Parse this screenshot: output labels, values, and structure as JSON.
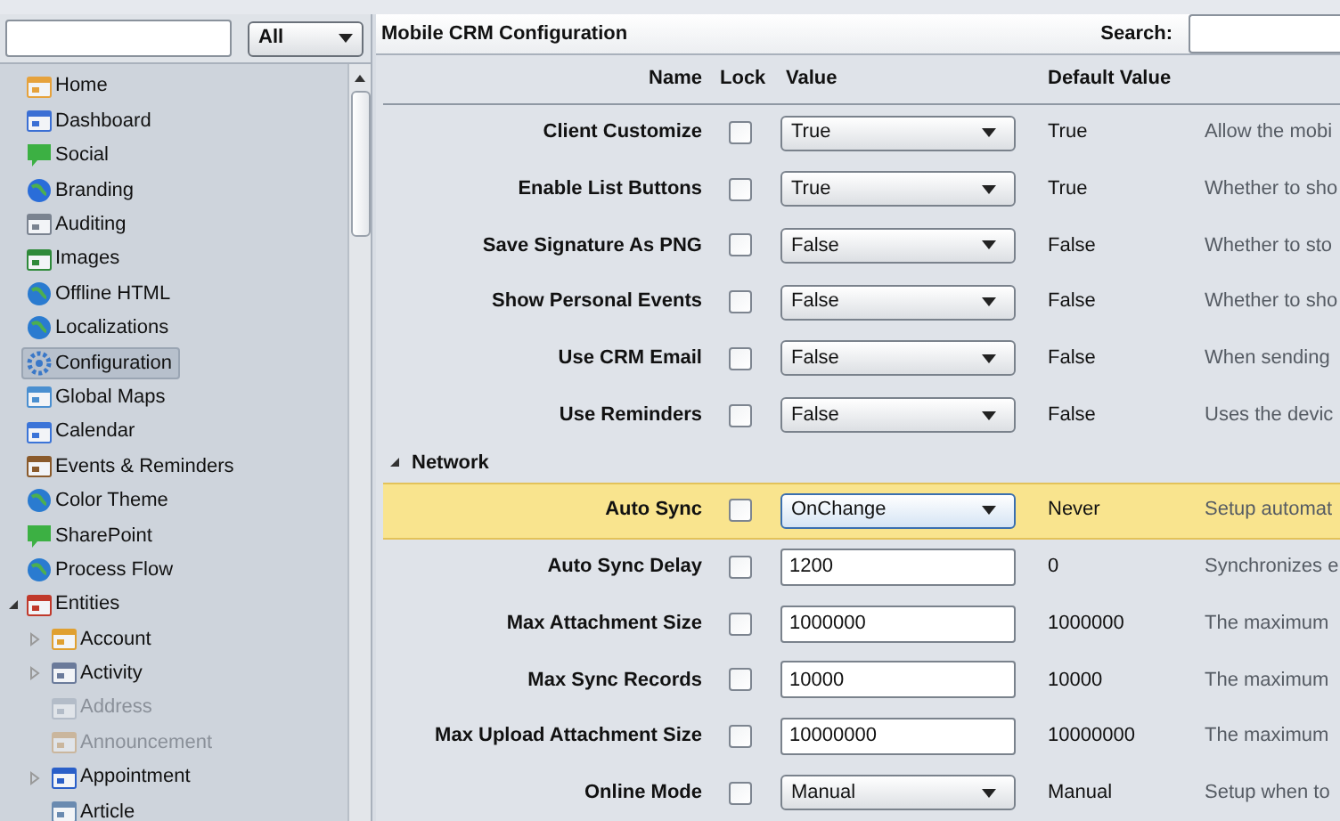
{
  "sidebar": {
    "filter": {
      "value": "All"
    },
    "items": [
      {
        "label": "Home",
        "selected": false
      },
      {
        "label": "Dashboard",
        "selected": false
      },
      {
        "label": "Social",
        "selected": false
      },
      {
        "label": "Branding",
        "selected": false
      },
      {
        "label": "Auditing",
        "selected": false
      },
      {
        "label": "Images",
        "selected": false
      },
      {
        "label": "Offline HTML",
        "selected": false
      },
      {
        "label": "Localizations",
        "selected": false
      },
      {
        "label": "Configuration",
        "selected": true
      },
      {
        "label": "Global Maps",
        "selected": false
      },
      {
        "label": "Calendar",
        "selected": false
      },
      {
        "label": "Events & Reminders",
        "selected": false
      },
      {
        "label": "Color Theme",
        "selected": false
      },
      {
        "label": "SharePoint",
        "selected": false
      },
      {
        "label": "Process Flow",
        "selected": false
      },
      {
        "label": "Entities",
        "selected": false,
        "expanded": true,
        "children": [
          {
            "label": "Account",
            "expandable": true,
            "disabled": false
          },
          {
            "label": "Activity",
            "expandable": true,
            "disabled": false
          },
          {
            "label": "Address",
            "expandable": false,
            "disabled": true
          },
          {
            "label": "Announcement",
            "expandable": false,
            "disabled": true
          },
          {
            "label": "Appointment",
            "expandable": true,
            "disabled": false
          },
          {
            "label": "Article",
            "expandable": false,
            "disabled": false
          }
        ]
      }
    ]
  },
  "main": {
    "title": "Mobile CRM Configuration",
    "search": {
      "label": "Search:"
    },
    "columns": [
      "Name",
      "Lock",
      "Value",
      "Default Value"
    ],
    "groups": [
      {
        "rows": [
          {
            "name": "Client Customize",
            "locked": false,
            "kind": "dropdown",
            "value": "True",
            "default": "True",
            "description": "Allow the mobi",
            "highlighted": false
          },
          {
            "name": "Enable List Buttons",
            "locked": false,
            "kind": "dropdown",
            "value": "True",
            "default": "True",
            "description": "Whether to sho",
            "highlighted": false
          },
          {
            "name": "Save Signature As PNG",
            "locked": false,
            "kind": "dropdown",
            "value": "False",
            "default": "False",
            "description": "Whether to sto",
            "highlighted": false
          },
          {
            "name": "Show Personal Events",
            "locked": false,
            "kind": "dropdown",
            "value": "False",
            "default": "False",
            "description": "Whether to sho",
            "highlighted": false
          },
          {
            "name": "Use CRM Email",
            "locked": false,
            "kind": "dropdown",
            "value": "False",
            "default": "False",
            "description": "When sending",
            "highlighted": false
          },
          {
            "name": "Use Reminders",
            "locked": false,
            "kind": "dropdown",
            "value": "False",
            "default": "False",
            "description": "Uses the devic",
            "highlighted": false
          }
        ]
      },
      {
        "title": "Network",
        "expanded": true,
        "rows": [
          {
            "name": "Auto Sync",
            "locked": false,
            "kind": "dropdown",
            "value": "OnChange",
            "default": "Never",
            "description": "Setup automat",
            "highlighted": true
          },
          {
            "name": "Auto Sync Delay",
            "locked": false,
            "kind": "text",
            "value": "1200",
            "default": "0",
            "description": "Synchronizes e",
            "highlighted": false
          },
          {
            "name": "Max Attachment Size",
            "locked": false,
            "kind": "text",
            "value": "1000000",
            "default": "1000000",
            "description": "The maximum",
            "highlighted": false
          },
          {
            "name": "Max Sync Records",
            "locked": false,
            "kind": "text",
            "value": "10000",
            "default": "10000",
            "description": "The maximum",
            "highlighted": false
          },
          {
            "name": "Max Upload Attachment Size",
            "locked": false,
            "kind": "text",
            "value": "10000000",
            "default": "10000000",
            "description": "The maximum",
            "highlighted": false
          },
          {
            "name": "Online Mode",
            "locked": false,
            "kind": "dropdown",
            "value": "Manual",
            "default": "Manual",
            "description": "Setup when to",
            "highlighted": false
          }
        ]
      }
    ]
  }
}
